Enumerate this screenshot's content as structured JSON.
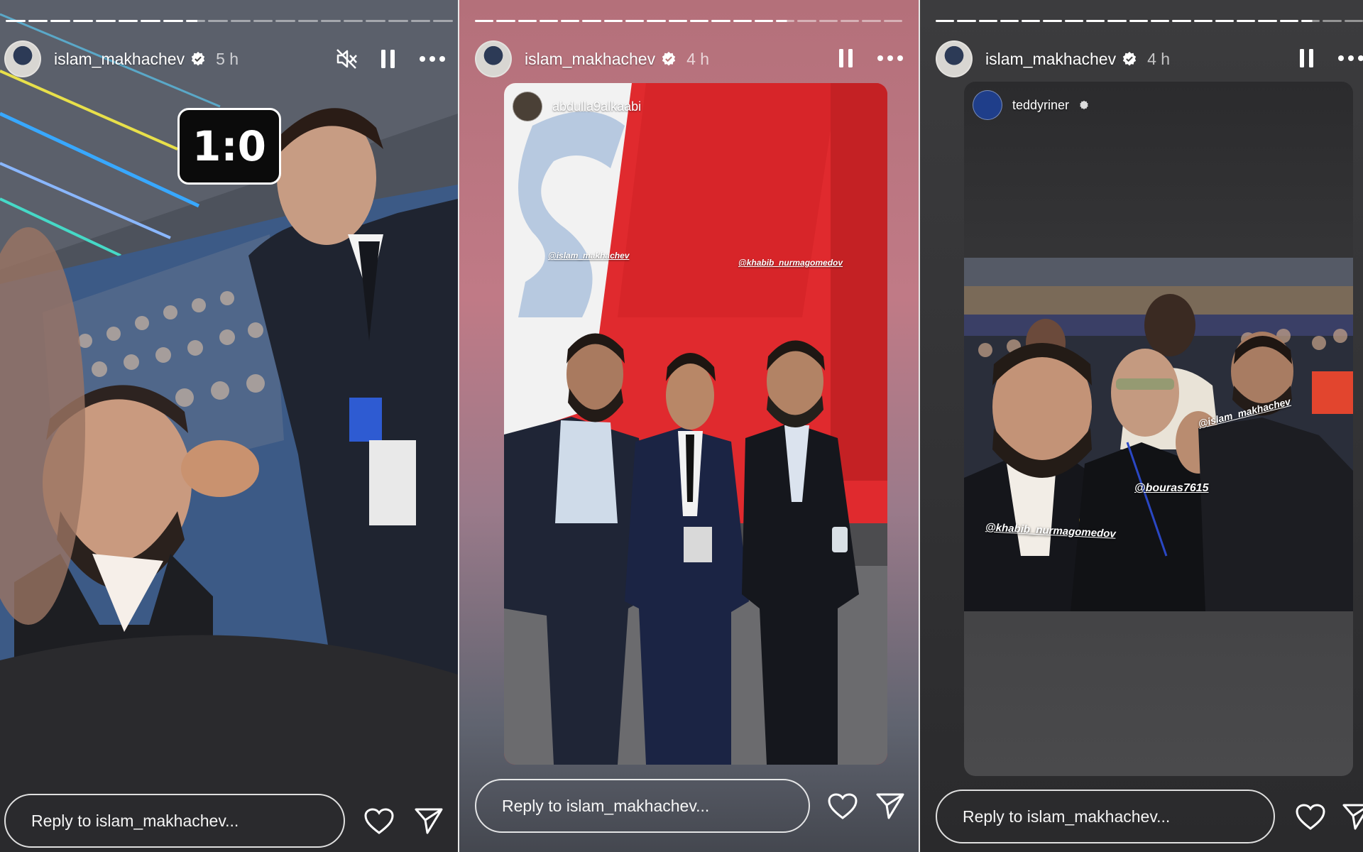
{
  "stories": [
    {
      "username": "islam_makhachev",
      "time": "5 h",
      "score_sticker": "1:0",
      "reply_placeholder": "Reply to islam_makhachev..."
    },
    {
      "username": "islam_makhachev",
      "time": "4 h",
      "shared_from": "abdulla9alkaabi",
      "tags": [
        "@islam_makhachev",
        "@khabib_nurmagomedov"
      ],
      "reply_placeholder": "Reply to islam_makhachev..."
    },
    {
      "username": "islam_makhachev",
      "time": "4 h",
      "shared_from": "teddyriner",
      "tags": [
        "@islam_makhachev",
        "@bouras7615",
        "@khabib_nurmagomedov"
      ],
      "reply_placeholder": "Reply to islam_makhachev..."
    }
  ],
  "icons": {
    "mute": "speaker-muted-icon",
    "pause": "pause-icon",
    "more": "more-dots-icon",
    "like": "heart-icon",
    "share": "send-icon",
    "verified": "verified-badge-icon"
  },
  "colors": {
    "verified": "#ffffff",
    "bus_red": "#e42a2f"
  }
}
